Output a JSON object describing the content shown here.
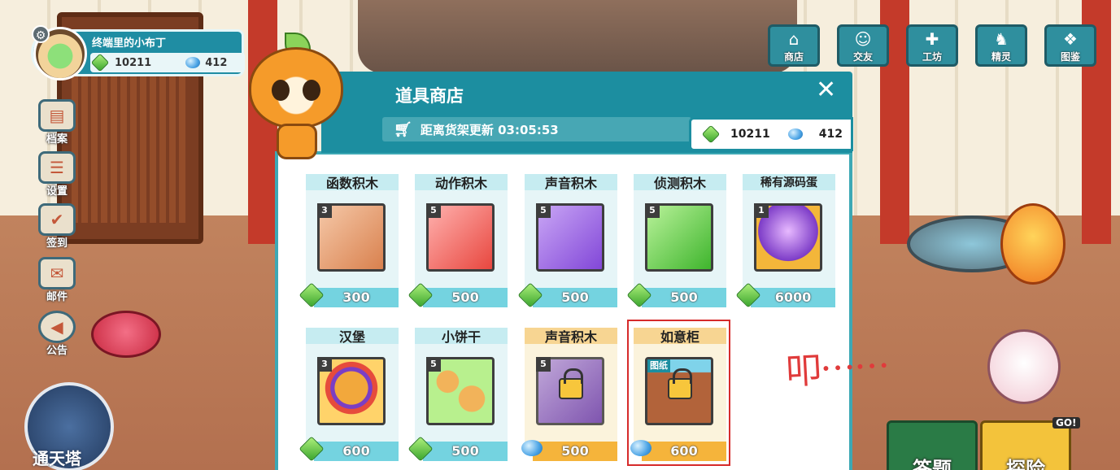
{
  "colors": {
    "panel_header": "#1c8ea0",
    "card_bar": "#c6ecf1",
    "card_price_bar": "#74d3e0",
    "card_gold_bar": "#f5b43b",
    "annotation": "#e03b3b"
  },
  "profile": {
    "name": "终端里的小布丁",
    "gems": "10211",
    "crystals": "412"
  },
  "left_menu": [
    {
      "label": "档案",
      "icon": "file-icon"
    },
    {
      "label": "设置",
      "icon": "settings-icon"
    },
    {
      "label": "签到",
      "icon": "calendar-icon"
    },
    {
      "label": "邮件",
      "icon": "mail-icon"
    },
    {
      "label": "公告",
      "icon": "megaphone-icon"
    }
  ],
  "top_nav": [
    {
      "label": "商店",
      "icon": "shop-icon"
    },
    {
      "label": "交友",
      "icon": "chat-icon"
    },
    {
      "label": "工坊",
      "icon": "tools-icon"
    },
    {
      "label": "精灵",
      "icon": "pet-icon"
    },
    {
      "label": "图鉴",
      "icon": "book-icon"
    }
  ],
  "shop": {
    "title": "道具商店",
    "timer_label": "距离货架更新 03:05:53",
    "gems": "10211",
    "crystals": "412",
    "close_label": "✕",
    "items": [
      {
        "title": "函数积木",
        "level": "3",
        "price": "300",
        "currency": "gem",
        "art": "PROCEDURE"
      },
      {
        "title": "动作积木",
        "level": "5",
        "price": "500",
        "currency": "gem",
        "art": "MOTION"
      },
      {
        "title": "声音积木",
        "level": "5",
        "price": "500",
        "currency": "gem",
        "art": "SOUND"
      },
      {
        "title": "侦测积木",
        "level": "5",
        "price": "500",
        "currency": "gem",
        "art": "SENSING"
      },
      {
        "title": "稀有源码蛋",
        "level": "1",
        "price": "6000",
        "currency": "gem",
        "art": ""
      },
      {
        "title": "汉堡",
        "level": "3",
        "price": "600",
        "currency": "gem",
        "art": ""
      },
      {
        "title": "小饼干",
        "level": "5",
        "price": "500",
        "currency": "gem",
        "art": ""
      },
      {
        "title": "声音积木",
        "level": "5",
        "price": "500",
        "currency": "crystal",
        "art": "SOUND",
        "locked": true
      },
      {
        "title": "如意柜",
        "tag": "图纸",
        "price": "600",
        "currency": "crystal",
        "locked": true
      }
    ]
  },
  "annotation_text": "叩⋯⋯",
  "bottom": {
    "tower_label": "通天塔",
    "answer_label": "答题",
    "explore_label": "探险",
    "go_badge": "GO!"
  }
}
